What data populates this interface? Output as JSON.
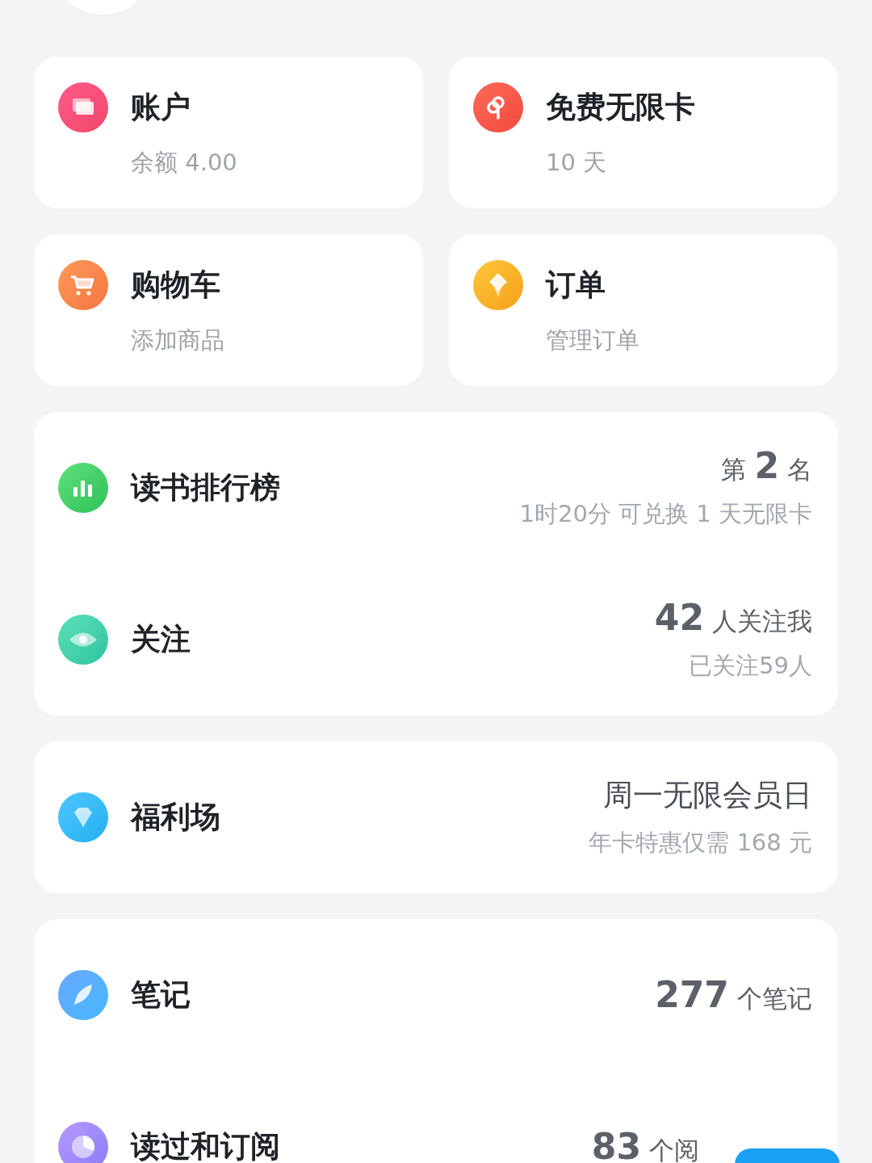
{
  "shortcuts": [
    {
      "title": "账户",
      "subtitle": "余额 4.00"
    },
    {
      "title": "免费无限卡",
      "subtitle": "10 天"
    },
    {
      "title": "购物车",
      "subtitle": "添加商品"
    },
    {
      "title": "订单",
      "subtitle": "管理订单"
    }
  ],
  "sections": [
    {
      "rows": [
        {
          "title": "读书排行榜",
          "kind": "stat",
          "prefix": "第",
          "number": "2",
          "suffix": "名",
          "note": "1时20分 可兑换 1 天无限卡"
        },
        {
          "title": "关注",
          "kind": "stat",
          "number": "42",
          "suffix": "人关注我",
          "note": "已关注59人"
        }
      ]
    },
    {
      "rows": [
        {
          "title": "福利场",
          "kind": "headline",
          "headline": "周一无限会员日",
          "note": "年卡特惠仅需 168 元"
        }
      ]
    },
    {
      "rows": [
        {
          "title": "笔记",
          "kind": "stat",
          "number": "277",
          "suffix": "个笔记"
        },
        {
          "title": "读过和订阅",
          "kind": "stat",
          "number": "83",
          "suffix": "个阅"
        }
      ]
    }
  ]
}
